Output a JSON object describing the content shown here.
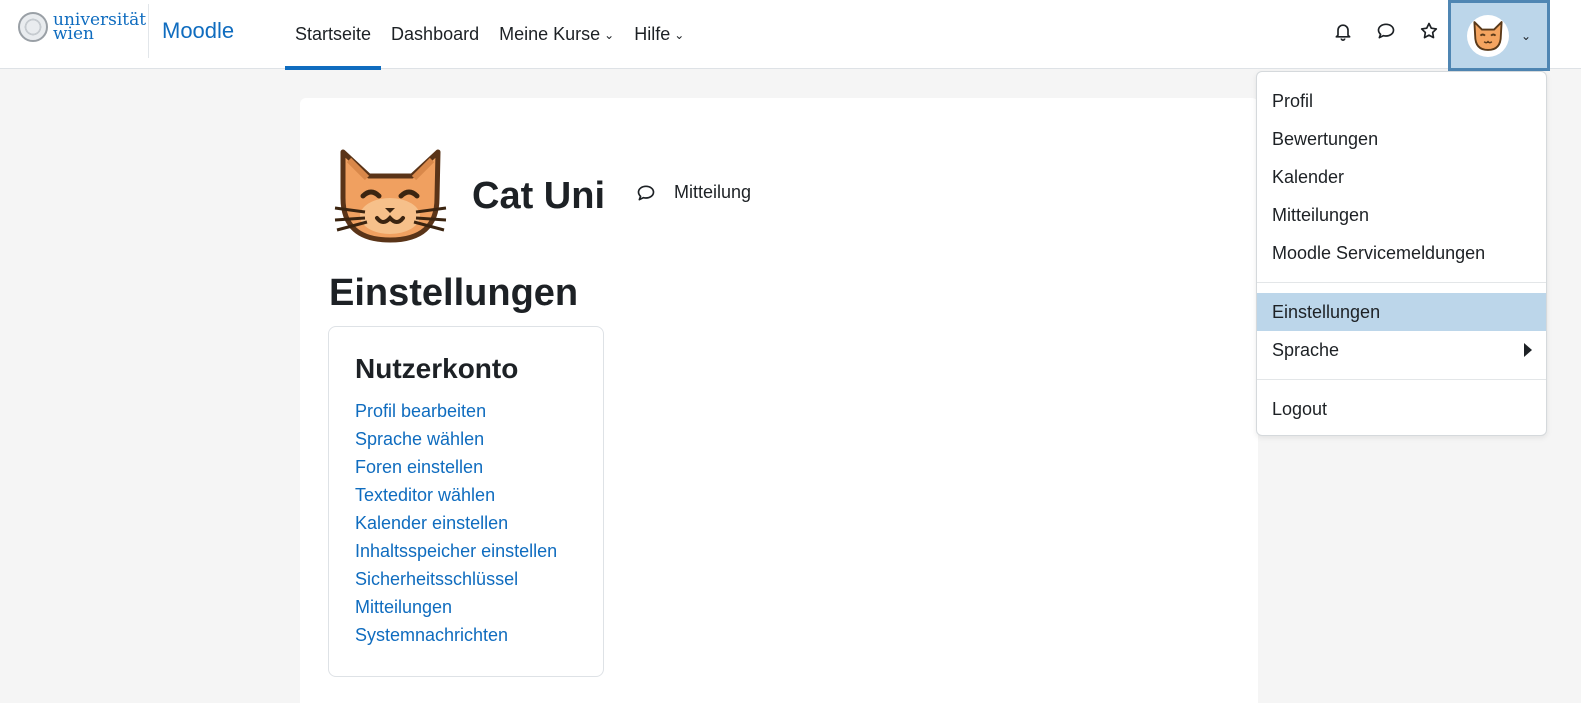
{
  "branding": {
    "logo_line1": "universität",
    "logo_line2": "wien",
    "site_name": "Moodle"
  },
  "nav": {
    "items": [
      {
        "label": "Startseite",
        "active": true,
        "dropdown": false
      },
      {
        "label": "Dashboard",
        "active": false,
        "dropdown": false
      },
      {
        "label": "Meine Kurse",
        "active": false,
        "dropdown": true
      },
      {
        "label": "Hilfe",
        "active": false,
        "dropdown": true
      }
    ],
    "icons": [
      "bell-icon",
      "chat-icon",
      "star-icon"
    ]
  },
  "user": {
    "name": "Cat Uni",
    "message_label": "Mitteilung"
  },
  "page": {
    "heading": "Einstellungen"
  },
  "card": {
    "title": "Nutzerkonto",
    "links": [
      "Profil bearbeiten",
      "Sprache wählen",
      "Foren einstellen",
      "Texteditor wählen",
      "Kalender einstellen",
      "Inhaltsspeicher einstellen",
      "Sicherheitsschlüssel",
      "Mitteilungen",
      "Systemnachrichten"
    ]
  },
  "dropdown": {
    "group1": [
      "Profil",
      "Bewertungen",
      "Kalender",
      "Mitteilungen",
      "Moodle Servicemeldungen"
    ],
    "group2": [
      "Einstellungen",
      "Sprache"
    ],
    "group3": [
      "Logout"
    ],
    "selected": "Einstellungen"
  },
  "colors": {
    "accent": "#0f6cbf",
    "selected_bg": "#bcd6ea",
    "page_bg": "#f5f5f5"
  }
}
